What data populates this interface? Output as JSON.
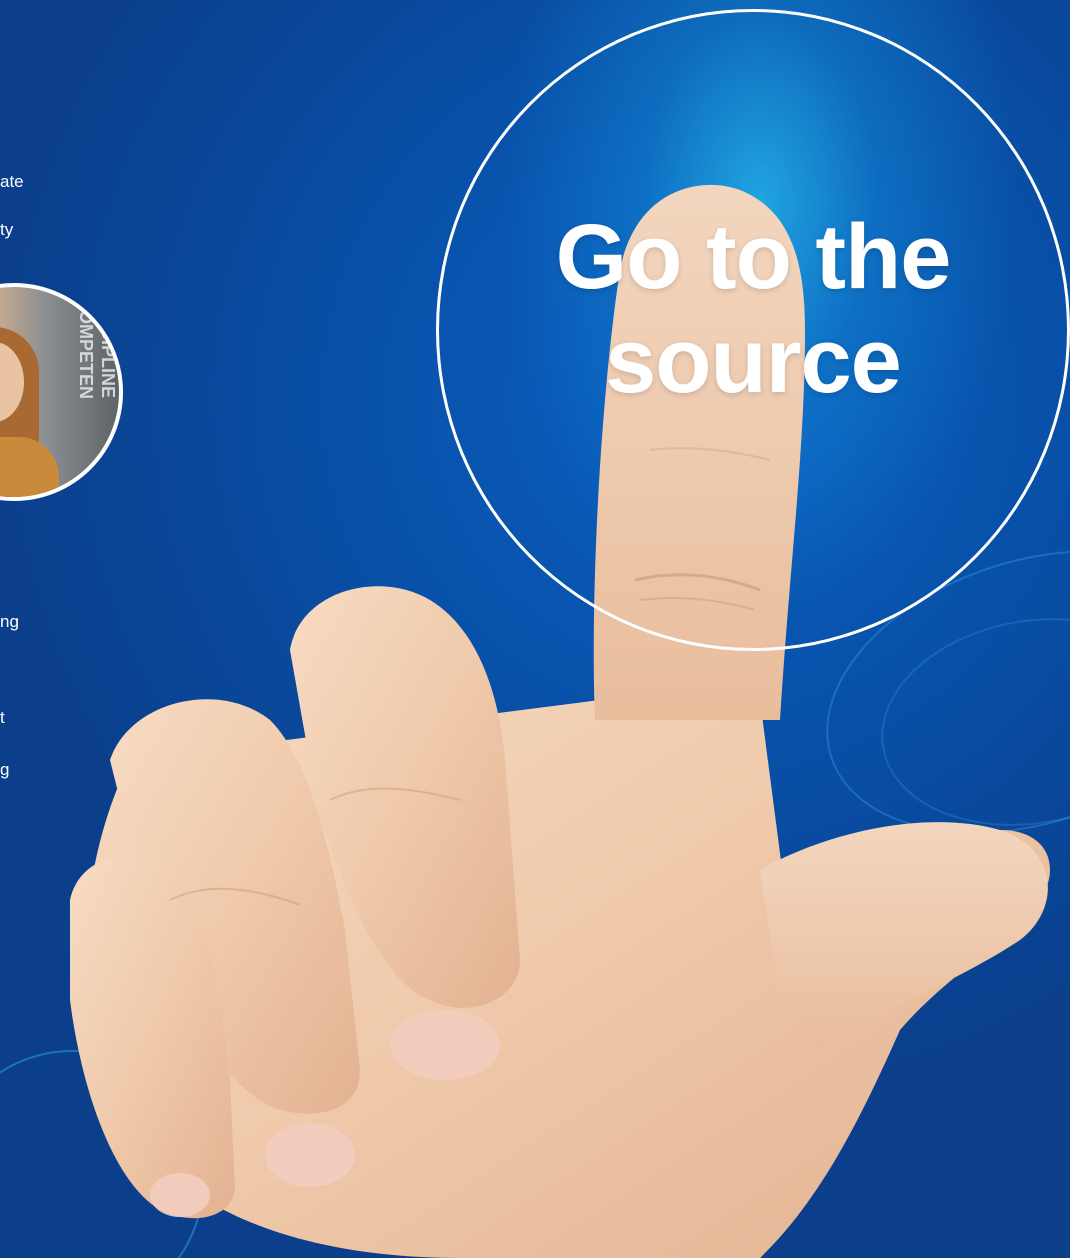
{
  "hero": {
    "cta_line1": "Go to the",
    "cta_line2": "source"
  },
  "side_text": {
    "line1": "ate",
    "line2": "ty",
    "line3": "ng",
    "line4": "t",
    "line5": "g"
  },
  "avatar": {
    "wall_text": "DISCIPLINE COMPETEN"
  },
  "colors": {
    "background": "#0a4ea6",
    "glow": "#28bef0",
    "circle_border": "#ffffff",
    "text": "#ffffff"
  }
}
